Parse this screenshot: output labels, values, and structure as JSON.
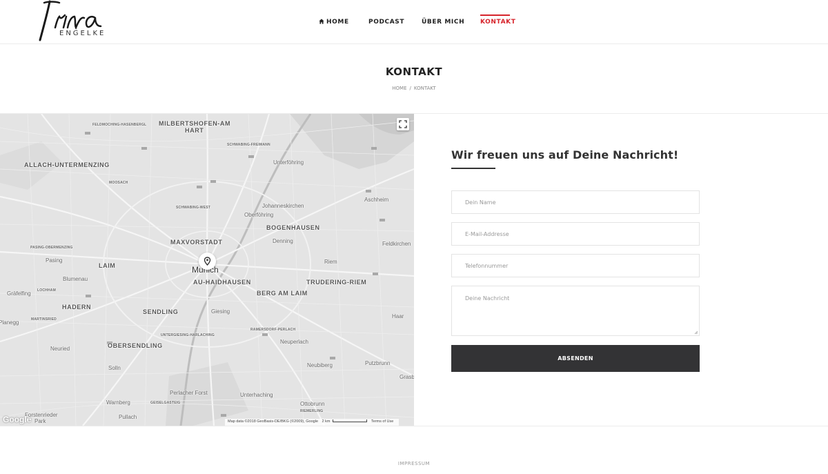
{
  "header": {
    "logo_script": "Irina",
    "logo_sub": "ENGELKE",
    "nav": [
      {
        "label": "HOME",
        "icon": "home-icon",
        "active": false
      },
      {
        "label": "PODCAST",
        "active": false
      },
      {
        "label": "ÜBER MICH",
        "active": false
      },
      {
        "label": "KONTAKT",
        "active": true
      }
    ]
  },
  "page": {
    "title": "KONTAKT",
    "breadcrumb": [
      "HOME",
      "KONTAKT"
    ],
    "breadcrumb_sep": "/"
  },
  "map": {
    "labels": [
      "FELDMOCHING-HASENBERGL",
      "MILBERTSHOFEN-AM",
      "HART",
      "SCHWABING-FREIMANN",
      "ALLACH-UNTERMENZING",
      "Unterföhring",
      "MOOSACH",
      "SCHWABING-WEST",
      "Johanneskirchen",
      "Aschheim",
      "Oberföhring",
      "BOGENHAUSEN",
      "MAXVORSTADT",
      "Denning",
      "PASING-OBERMENZING",
      "Feldkirchen",
      "Pasing",
      "LAIM",
      "Munich",
      "Riem",
      "Blumenau",
      "AU-HAIDHAUSEN",
      "TRUDERING-RIEM",
      "LOCHHAM",
      "Gräfelfing",
      "HADERN",
      "BERG AM LAIM",
      "SENDLING",
      "Giesing",
      "MARTINSRIED",
      "Haar",
      "Planegg",
      "RAMERSDORF-PERLACH",
      "UNTERGIESING-HARLACHING",
      "Neuperlach",
      "OBERSENDLING",
      "Neuried",
      "Solln",
      "Neubiberg",
      "Putzbrunn",
      "Grasbrunn",
      "Perlacher Forst",
      "Unterhaching",
      "Warnberg",
      "GEISELGASTEIG",
      "Ottobrunn",
      "Forstenrieder",
      "Park",
      "Pullach",
      "RIEMERLING"
    ],
    "google": "Google",
    "attribution": "Map data ©2018 GeoBasis-DE/BKG (©2009), Google",
    "scale": "2 km",
    "terms": "Terms of Use",
    "fullscreen_icon": "fullscreen-icon",
    "marker_icon": "location-pin-icon"
  },
  "form": {
    "title": "Wir freuen uns auf Deine Nachricht!",
    "name_placeholder": "Dein Name",
    "email_placeholder": "E-Mail-Addresse",
    "phone_placeholder": "Telefonnummer",
    "message_placeholder": "Deine Nachricht",
    "submit_label": "ABSENDEN"
  },
  "footer": {
    "link": "IMPRESSUM"
  },
  "colors": {
    "accent": "#d6232b",
    "button": "#333335",
    "map_bg": "#e4e4e4"
  }
}
